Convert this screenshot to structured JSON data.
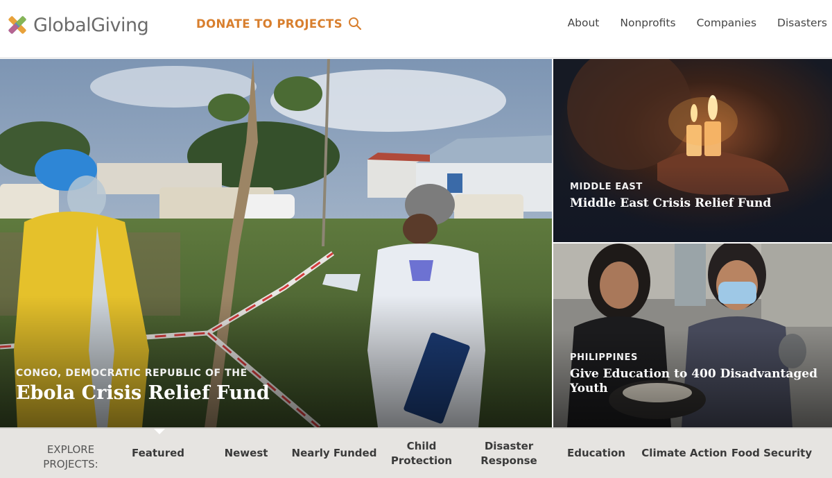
{
  "header": {
    "logo_text": "GlobalGiving",
    "donate_label": "DONATE TO PROJECTS",
    "nav": [
      "About",
      "Nonprofits",
      "Companies",
      "Disasters"
    ]
  },
  "hero": {
    "main": {
      "country": "CONGO, DEMOCRATIC REPUBLIC OF THE",
      "title": "Ebola Crisis Relief Fund"
    },
    "top_right": {
      "country": "MIDDLE EAST",
      "title": "Middle East Crisis Relief Fund"
    },
    "bottom_right": {
      "country": "PHILIPPINES",
      "title": "Give Education to 400 Disadvantaged Youth"
    }
  },
  "explore": {
    "label": "EXPLORE PROJECTS:",
    "tabs": [
      "Featured",
      "Newest",
      "Nearly Funded",
      "Child Protection",
      "Disaster Response",
      "Education",
      "Climate Action",
      "Food Security"
    ],
    "active_tab": "Featured"
  },
  "colors": {
    "accent": "#d87f2e",
    "logo_gray": "#6b6b6b",
    "explore_bg": "#e6e4e1",
    "logo_mark": [
      "#e8a23b",
      "#8bb84a",
      "#4a8ec7",
      "#c55a86"
    ]
  },
  "icons": {
    "logo": "globalgiving-logo-mark",
    "search": "search-icon"
  }
}
